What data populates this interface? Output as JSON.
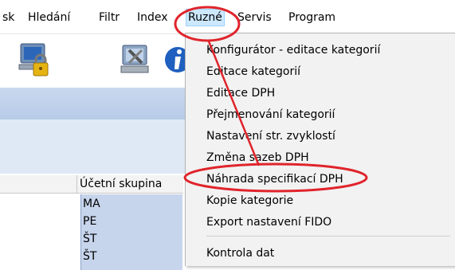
{
  "menubar": {
    "items": [
      {
        "label": "sk"
      },
      {
        "label": "Hledání"
      },
      {
        "label": "Filtr"
      },
      {
        "label": "Index"
      },
      {
        "label": "Ruzné"
      },
      {
        "label": "Servis"
      },
      {
        "label": "Program"
      }
    ]
  },
  "toolbar": {
    "icons": [
      "computer-lock-icon",
      "computer-tools-icon",
      "info-icon"
    ]
  },
  "grid": {
    "column_header": "Účetní skupina",
    "cells": [
      "MA",
      "PE",
      "ŠT",
      "ŠT"
    ]
  },
  "dropdown": {
    "items": [
      {
        "label": "Konfigurátor - editace kategorií"
      },
      {
        "label": "Editace kategorií"
      },
      {
        "label": "Editace DPH"
      },
      {
        "label": "Přejmenování kategorií"
      },
      {
        "label": "Nastavení str. zvyklostí"
      },
      {
        "label": "Změna sazeb DPH"
      },
      {
        "label": "Náhrada specifikací DPH"
      },
      {
        "label": "Kopie kategorie"
      },
      {
        "label": "Export nastavení FIDO"
      },
      {
        "label": "Kontrola dat"
      }
    ]
  },
  "colors": {
    "annotation": "#e0242b",
    "menu_highlight": "#cce8ff",
    "grid_selection": "#c7d5ec"
  }
}
